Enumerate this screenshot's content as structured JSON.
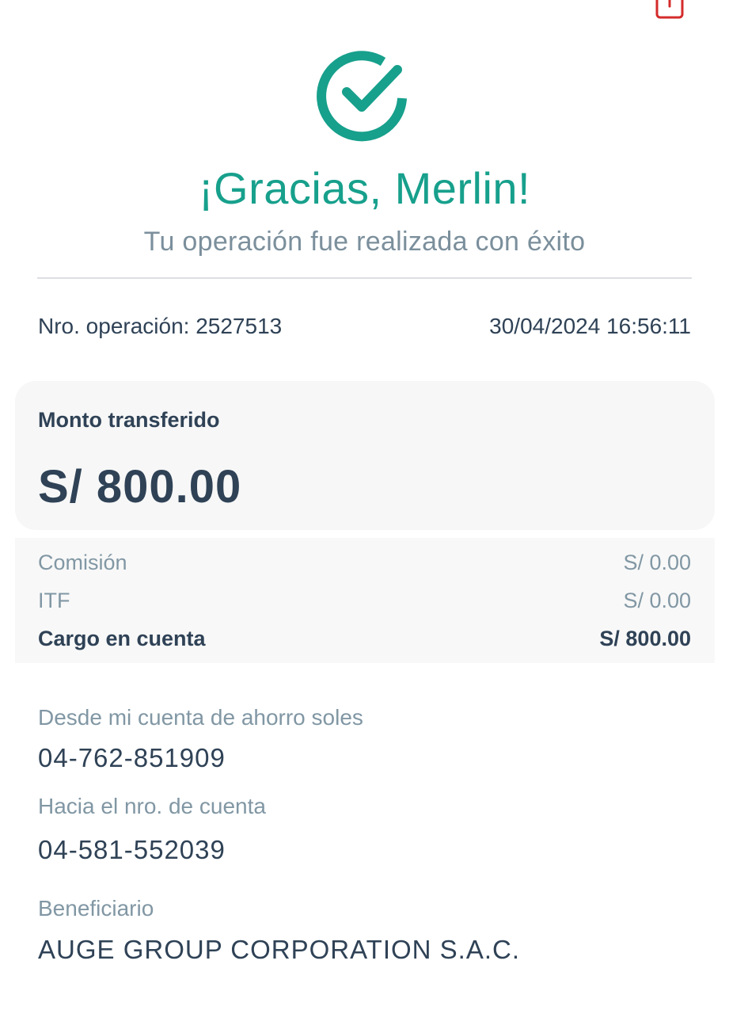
{
  "header": {
    "title": "¡Gracias, Merlin!",
    "subtitle": "Tu operación fue realizada con éxito",
    "share_icon": "share-icon",
    "success_icon": "check-circle-icon"
  },
  "operation": {
    "number_text": "Nro. operación: 2527513",
    "datetime": "30/04/2024 16:56:11"
  },
  "amount": {
    "label": "Monto transferido",
    "value": "S/ 800.00"
  },
  "fees": [
    {
      "label": "Comisión",
      "value": "S/ 0.00"
    },
    {
      "label": "ITF",
      "value": "S/ 0.00"
    },
    {
      "label": "Cargo en cuenta",
      "value": "S/ 800.00"
    }
  ],
  "details": {
    "from_label": "Desde mi cuenta de ahorro soles",
    "from_value": "04-762-851909",
    "to_label": "Hacia el nro. de cuenta",
    "to_value": "04-581-552039",
    "beneficiary_label": "Beneficiario",
    "beneficiary_value": "AUGE GROUP CORPORATION S.A.C."
  },
  "colors": {
    "accent": "#17a08c",
    "text_primary": "#2f4256",
    "text_secondary": "#8197a4",
    "share_red": "#d42b2b"
  }
}
